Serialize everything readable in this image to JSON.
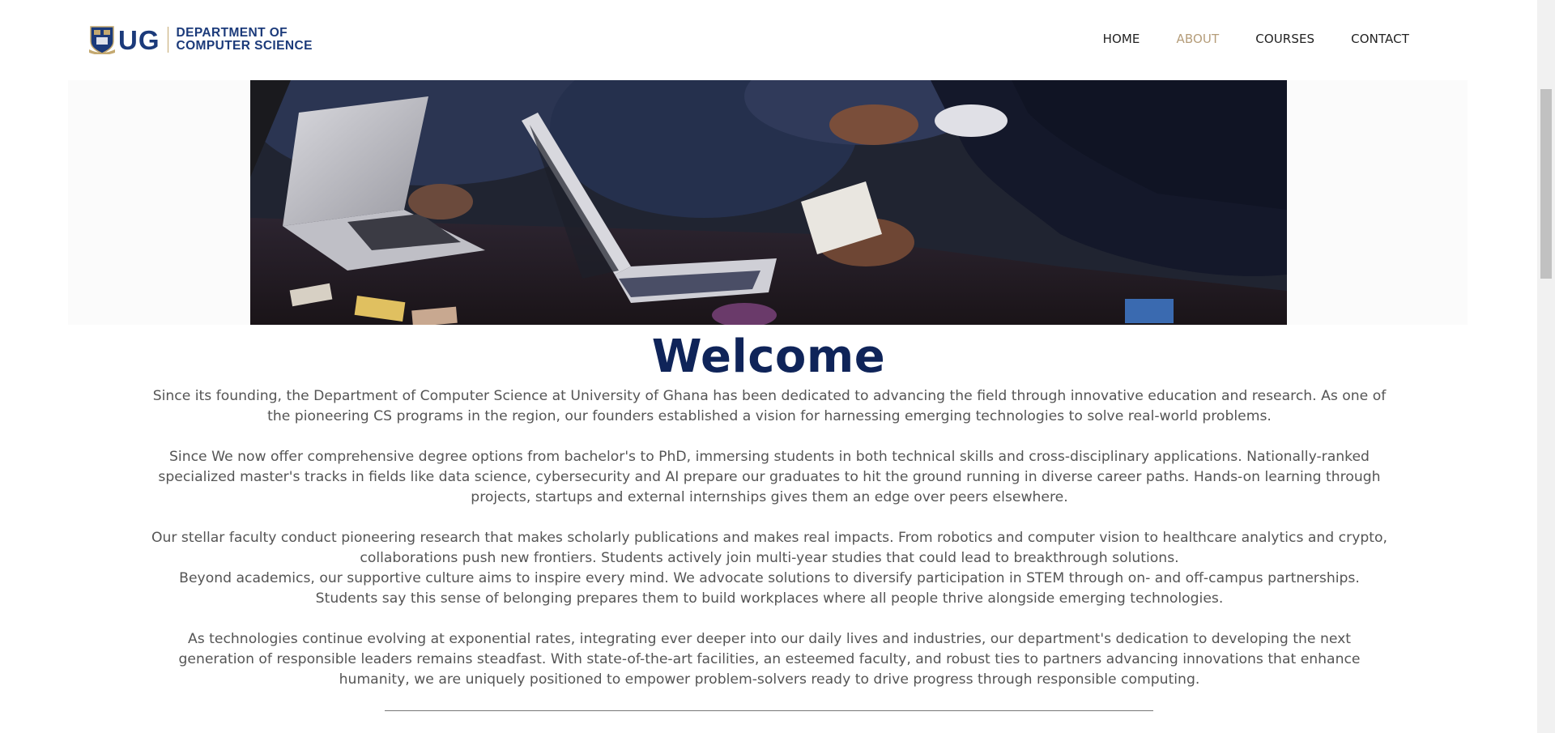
{
  "header": {
    "logo_mark": "UG",
    "dept_line1": "DEPARTMENT OF",
    "dept_line2": "COMPUTER SCIENCE",
    "nav": [
      {
        "label": "HOME",
        "active": false
      },
      {
        "label": "ABOUT",
        "active": true
      },
      {
        "label": "COURSES",
        "active": false
      },
      {
        "label": "CONTACT",
        "active": false
      }
    ]
  },
  "colors": {
    "brand_navy": "#0f2459",
    "nav_active": "#b59d7a",
    "logo_blue": "#1b3a7a"
  },
  "hero": {
    "image_icon": "students-laptops-photo"
  },
  "main": {
    "title": "Welcome",
    "paragraphs": [
      "Since its founding, the Department of Computer Science at University of Ghana has been dedicated to advancing the field through innovative education and research. As one of the pioneering CS programs in the region, our founders established a vision for harnessing emerging technologies to solve real-world problems.",
      "Since We now offer comprehensive degree options from bachelor's to PhD, immersing students in both technical skills and cross-disciplinary applications. Nationally-ranked specialized master's tracks in fields like data science, cybersecurity and AI prepare our graduates to hit the ground running in diverse career paths. Hands-on learning through projects, startups and external internships gives them an edge over peers elsewhere.",
      "Our stellar faculty conduct pioneering research that makes scholarly publications and makes real impacts. From robotics and computer vision to healthcare analytics and crypto, collaborations push new frontiers. Students actively join multi-year studies that could lead to breakthrough solutions.",
      "Beyond academics, our supportive culture aims to inspire every mind. We advocate solutions to diversify participation in STEM through on- and off-campus partnerships. Students say this sense of belonging prepares them to build workplaces where all people thrive alongside emerging technologies.",
      "As technologies continue evolving at exponential rates, integrating ever deeper into our daily lives and industries, our department's dedication to developing the next generation of responsible leaders remains steadfast. With state-of-the-art facilities, an esteemed faculty, and robust ties to partners advancing innovations that enhance humanity, we are uniquely positioned to empower problem-solvers ready to drive progress through responsible computing."
    ]
  }
}
